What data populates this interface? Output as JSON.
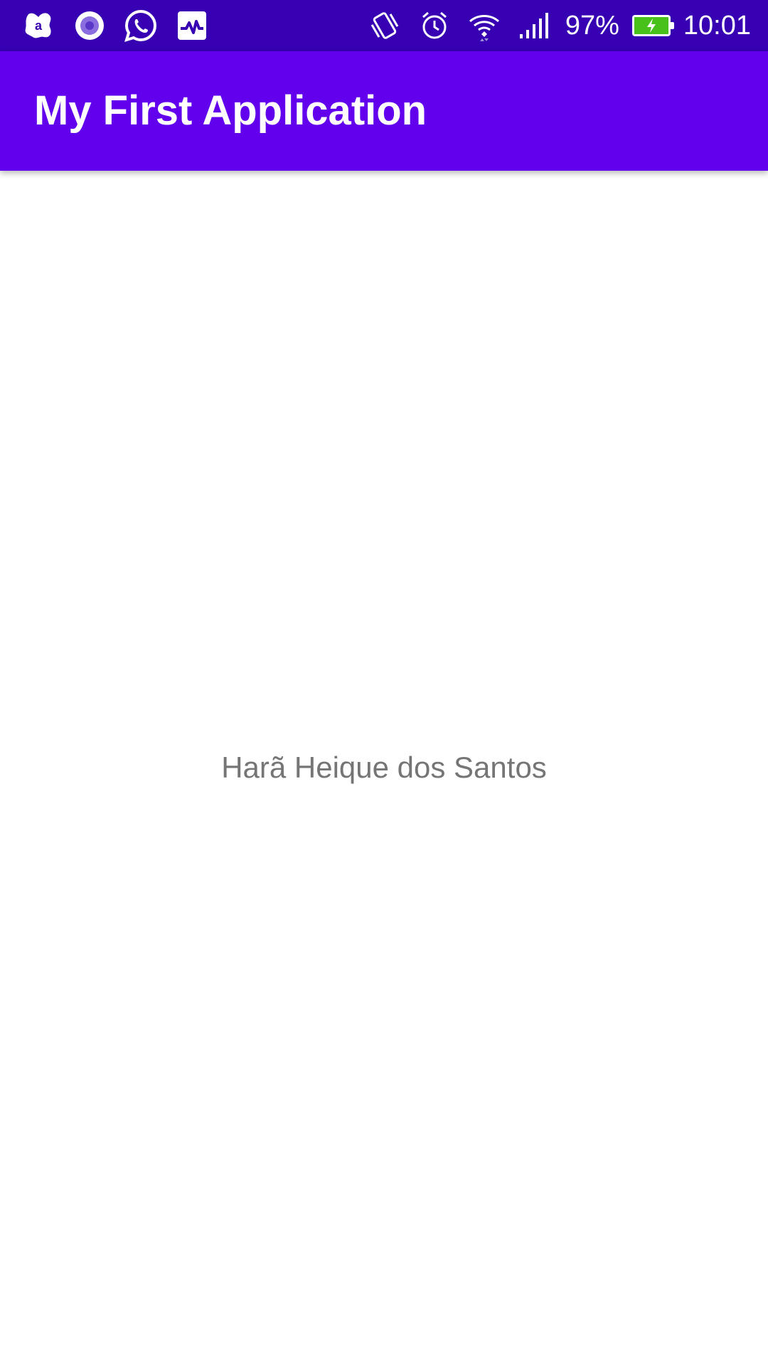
{
  "status_bar": {
    "left_icons": [
      "avast-icon",
      "screen-recorder-icon",
      "whatsapp-icon",
      "activity-monitor-icon"
    ],
    "right_icons": [
      "vibrate-icon",
      "alarm-icon",
      "wifi-icon",
      "signal-icon"
    ],
    "battery_percent_text": "97%",
    "battery_level": 0.97,
    "battery_charging": true,
    "time": "10:01",
    "background_color": "#3700B3"
  },
  "app_bar": {
    "title": "My First Application",
    "background_color": "#6200EE"
  },
  "main": {
    "text": "Harã Heique dos Santos"
  }
}
